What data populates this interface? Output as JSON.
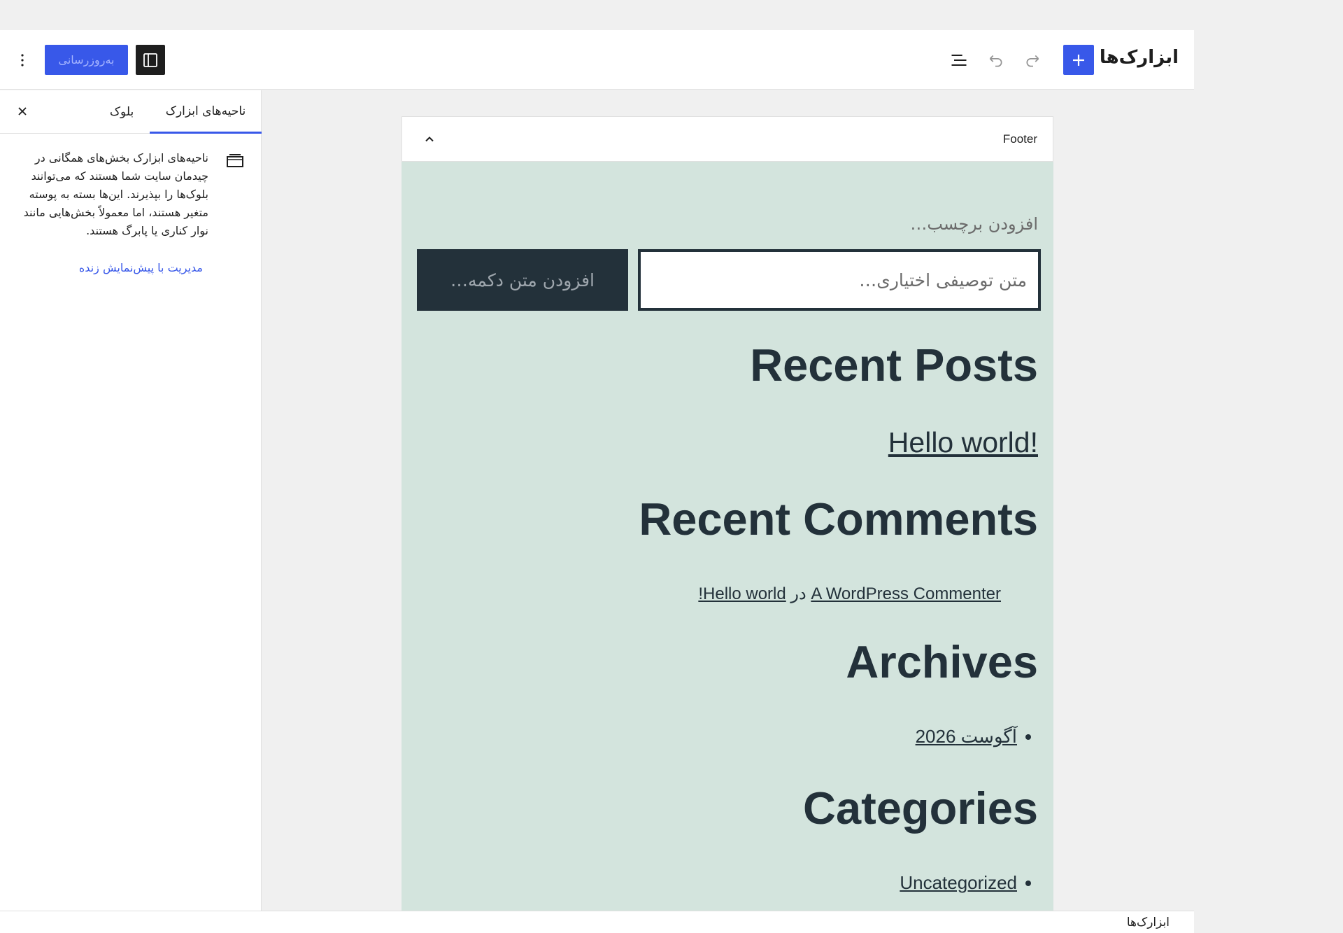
{
  "header": {
    "title": "ابزارک‌ها",
    "update_label": "به‌روزرسانی",
    "icons": [
      "plus-icon",
      "redo-icon",
      "undo-icon",
      "list-view-icon",
      "sidebar-icon",
      "more-vertical-icon"
    ],
    "accent": "#3858e9"
  },
  "panel": {
    "tabs": [
      {
        "label": "ناحیه‌های ابزارک",
        "active": true
      },
      {
        "label": "بلوک",
        "active": false
      }
    ],
    "description": "ناحیه‌های ابزارک بخش‌های همگانی در چیدمان سایت شما هستند که می‌توانند بلوک‌ها را بپذیرند. این‌ها بسته به پوسته متغیر هستند، اما معمولاً بخش‌هایی مانند نوار کناری یا پابرگ هستند.",
    "link": "مدیریت با پیش‌نمایش زنده"
  },
  "canvas": {
    "area_name": "Footer",
    "background": "#d3e4dd",
    "search": {
      "label_placeholder": "افزودن برچسب…",
      "input_placeholder": "متن توصیفی اختیاری…",
      "button_placeholder": "افزودن متن دکمه…"
    },
    "recent_posts": {
      "heading": "Recent Posts",
      "post": "Hello world!"
    },
    "recent_comments": {
      "heading": "Recent Comments",
      "author": "A WordPress Commenter",
      "connector": "در",
      "post": "Hello world!"
    },
    "archives": {
      "heading": "Archives",
      "item": "آگوست 2026"
    },
    "categories": {
      "heading": "Categories",
      "item": "Uncategorized"
    }
  },
  "breadcrumb": "ابزارک‌ها"
}
